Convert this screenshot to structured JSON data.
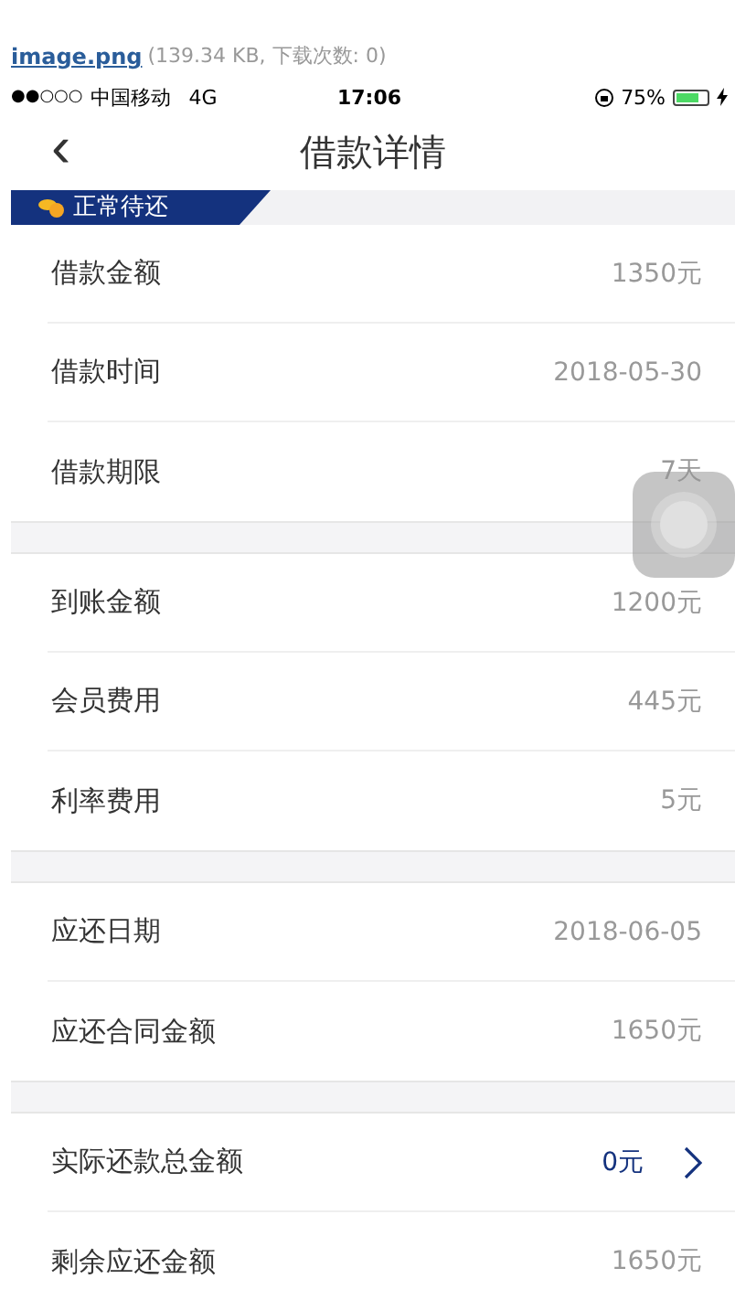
{
  "attachment": {
    "filename": "image.png",
    "info": "(139.34 KB, 下载次数: 0)"
  },
  "status_bar": {
    "signal": "●●○○○",
    "carrier": "中国移动",
    "network": "4G",
    "time": "17:06",
    "battery": "75%"
  },
  "nav": {
    "back": "‹",
    "title": "借款详情"
  },
  "badge": {
    "label": "正常待还"
  },
  "groups": [
    {
      "rows": [
        {
          "kind": "plain",
          "label": "借款金额",
          "value": "1350元"
        },
        {
          "kind": "plain",
          "label": "借款时间",
          "value": "2018-05-30"
        },
        {
          "kind": "plain",
          "label": "借款期限",
          "value": "7天"
        }
      ]
    },
    {
      "rows": [
        {
          "kind": "plain",
          "label": "到账金额",
          "value": "1200元"
        },
        {
          "kind": "plain",
          "label": "会员费用",
          "value": "445元"
        },
        {
          "kind": "plain",
          "label": "利率费用",
          "value": "5元"
        }
      ]
    },
    {
      "rows": [
        {
          "kind": "plain",
          "label": "应还日期",
          "value": "2018-06-05"
        },
        {
          "kind": "plain",
          "label": "应还合同金额",
          "value": "1650元"
        }
      ]
    },
    {
      "rows": [
        {
          "kind": "link",
          "label": "实际还款总金额",
          "value": "0元"
        },
        {
          "kind": "plain",
          "label": "剩余应还金额",
          "value": "1650元"
        }
      ]
    }
  ]
}
